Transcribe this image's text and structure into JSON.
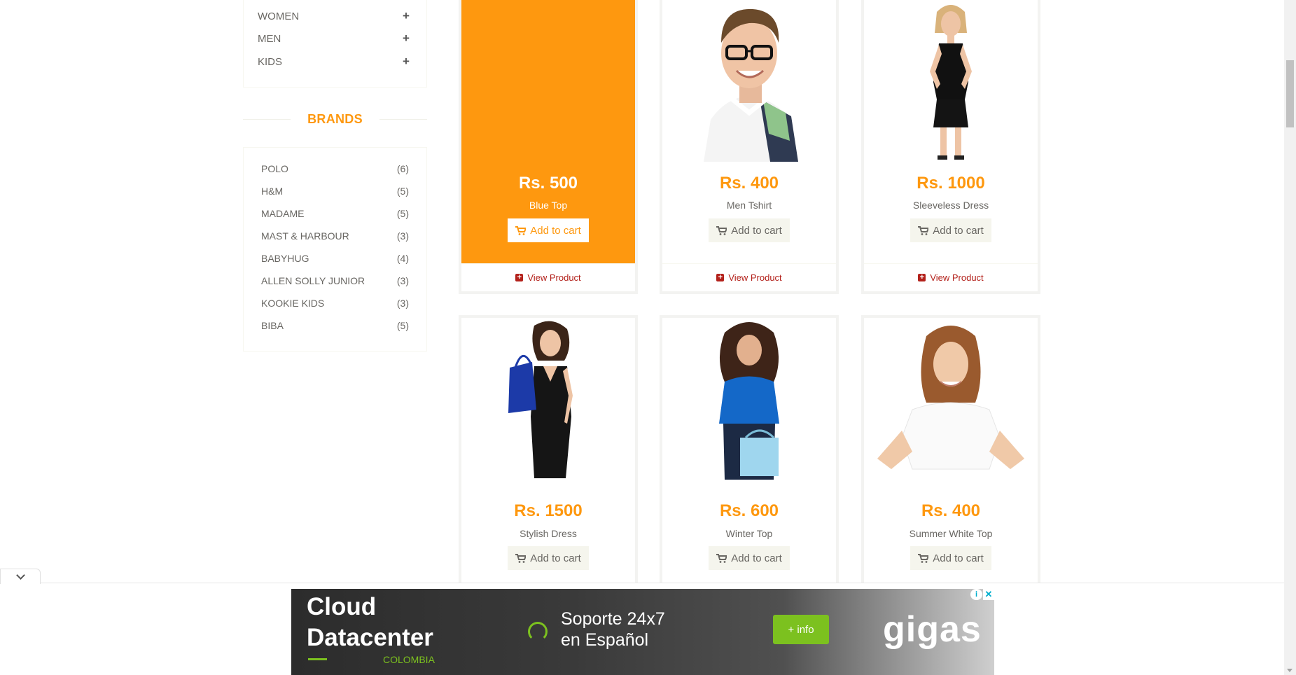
{
  "sidebar": {
    "categories": [
      {
        "label": "WOMEN"
      },
      {
        "label": "MEN"
      },
      {
        "label": "KIDS"
      }
    ],
    "brands_title": "BRANDS",
    "brands": [
      {
        "name": "POLO",
        "count": "(6)"
      },
      {
        "name": "H&M",
        "count": "(5)"
      },
      {
        "name": "MADAME",
        "count": "(5)"
      },
      {
        "name": "MAST & HARBOUR",
        "count": "(3)"
      },
      {
        "name": "BABYHUG",
        "count": "(4)"
      },
      {
        "name": "ALLEN SOLLY JUNIOR",
        "count": "(3)"
      },
      {
        "name": "KOOKIE KIDS",
        "count": "(3)"
      },
      {
        "name": "BIBA",
        "count": "(5)"
      }
    ]
  },
  "products": [
    {
      "price": "Rs. 500",
      "name": "Blue Top",
      "cart": "Add to cart",
      "view": "View Product"
    },
    {
      "price": "Rs. 400",
      "name": "Men Tshirt",
      "cart": "Add to cart",
      "view": "View Product"
    },
    {
      "price": "Rs. 1000",
      "name": "Sleeveless Dress",
      "cart": "Add to cart",
      "view": "View Product"
    },
    {
      "price": "Rs. 1500",
      "name": "Stylish Dress",
      "cart": "Add to cart"
    },
    {
      "price": "Rs. 600",
      "name": "Winter Top",
      "cart": "Add to cart"
    },
    {
      "price": "Rs. 400",
      "name": "Summer White Top",
      "cart": "Add to cart"
    }
  ],
  "ad": {
    "title_line1": "Cloud",
    "title_line2": "Datacenter",
    "country": "COLOMBIA",
    "support_line1": "Soporte 24x7",
    "support_line2": "en Español",
    "button": "+ info",
    "logo": "gigas",
    "info_icon": "i",
    "close_icon": "✕"
  },
  "colors": {
    "accent": "#FE980F",
    "view_product": "#B3211B",
    "ad_green": "#7cc11f"
  }
}
